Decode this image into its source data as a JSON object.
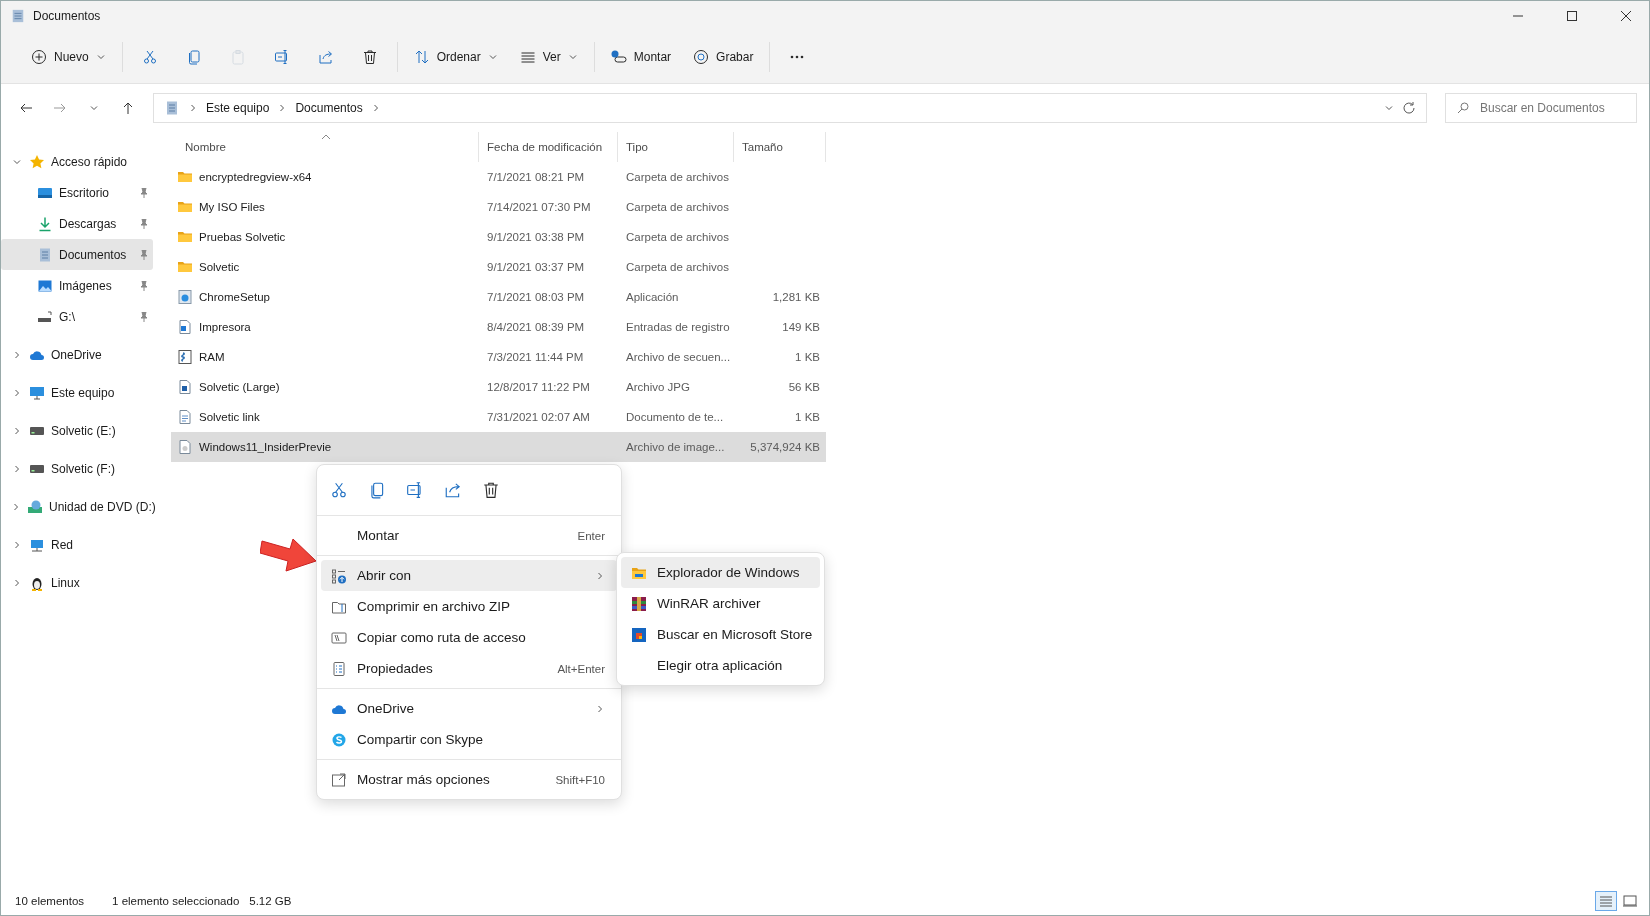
{
  "window": {
    "title": "Documentos"
  },
  "toolbar": {
    "groups": [
      [
        {
          "kind": "new",
          "label": "Nuevo",
          "dropdown": true,
          "disabled": false
        }
      ],
      [
        {
          "kind": "cut",
          "disabled": false
        },
        {
          "kind": "copy",
          "disabled": false
        },
        {
          "kind": "paste",
          "disabled": true
        },
        {
          "kind": "rename",
          "disabled": false
        },
        {
          "kind": "share",
          "disabled": false
        },
        {
          "kind": "delete",
          "disabled": false
        }
      ],
      [
        {
          "kind": "sort",
          "label": "Ordenar",
          "dropdown": true,
          "disabled": false
        },
        {
          "kind": "view",
          "label": "Ver",
          "dropdown": true,
          "disabled": false
        }
      ],
      [
        {
          "kind": "mount",
          "label": "Montar",
          "dropdown": false,
          "disabled": false
        },
        {
          "kind": "burn",
          "label": "Grabar",
          "dropdown": false,
          "disabled": false
        }
      ],
      [
        {
          "kind": "more",
          "disabled": false
        }
      ]
    ]
  },
  "address": {
    "breadcrumb": [
      "Este equipo",
      "Documentos"
    ]
  },
  "search": {
    "placeholder": "Buscar en Documentos"
  },
  "sidebar": {
    "items": [
      {
        "label": "Acceso rápido",
        "kind": "star",
        "expanded": true,
        "selected": false,
        "children": [
          {
            "label": "Escritorio",
            "kind": "desktop",
            "pinned": true,
            "selected": false
          },
          {
            "label": "Descargas",
            "kind": "download",
            "pinned": true,
            "selected": false
          },
          {
            "label": "Documentos",
            "kind": "documents",
            "pinned": true,
            "selected": true
          },
          {
            "label": "Imágenes",
            "kind": "pictures",
            "pinned": true,
            "selected": false
          },
          {
            "label": "G:\\",
            "kind": "usb",
            "pinned": true,
            "selected": false
          }
        ]
      },
      {
        "label": "OneDrive",
        "kind": "cloud",
        "expanded": false,
        "selected": false
      },
      {
        "label": "Este equipo",
        "kind": "computer",
        "expanded": false,
        "selected": false
      },
      {
        "label": "Solvetic (E:)",
        "kind": "drive",
        "expanded": false,
        "selected": false
      },
      {
        "label": "Solvetic (F:)",
        "kind": "drive",
        "expanded": false,
        "selected": false
      },
      {
        "label": "Unidad de DVD (D:)",
        "kind": "dvd",
        "expanded": false,
        "selected": false
      },
      {
        "label": "Red",
        "kind": "network",
        "expanded": false,
        "selected": false
      },
      {
        "label": "Linux",
        "kind": "linux",
        "expanded": false,
        "selected": false
      }
    ]
  },
  "table": {
    "columns": [
      "Nombre",
      "Fecha de modificación",
      "Tipo",
      "Tamaño"
    ],
    "rows": [
      {
        "kind": "folder",
        "name": "encryptedregview-x64",
        "date": "7/1/2021 08:21 PM",
        "type": "Carpeta de archivos",
        "selected": false
      },
      {
        "kind": "folder",
        "name": "My ISO Files",
        "date": "7/14/2021 07:30 PM",
        "type": "Carpeta de archivos",
        "selected": false
      },
      {
        "kind": "folder",
        "name": "Pruebas Solvetic",
        "date": "9/1/2021 03:38 PM",
        "type": "Carpeta de archivos",
        "selected": false
      },
      {
        "kind": "folder",
        "name": "Solvetic",
        "date": "9/1/2021 03:37 PM",
        "type": "Carpeta de archivos",
        "selected": false
      },
      {
        "kind": "app",
        "name": "ChromeSetup",
        "date": "7/1/2021 08:03 PM",
        "type": "Aplicación",
        "size": "1,281 KB",
        "selected": false
      },
      {
        "kind": "registry",
        "name": "Impresora",
        "date": "8/4/2021 08:39 PM",
        "type": "Entradas de registro",
        "size": "149 KB",
        "selected": false
      },
      {
        "kind": "script",
        "name": "RAM",
        "date": "7/3/2021 11:44 PM",
        "type": "Archivo de secuen...",
        "size": "1 KB",
        "selected": false
      },
      {
        "kind": "image",
        "name": "Solvetic (Large)",
        "date": "12/8/2017 11:22 PM",
        "type": "Archivo JPG",
        "size": "56 KB",
        "selected": false
      },
      {
        "kind": "link",
        "name": "Solvetic link",
        "date": "7/31/2021 02:07 AM",
        "type": "Documento de te...",
        "size": "1 KB",
        "selected": false
      },
      {
        "kind": "disc",
        "name": "Windows11_InsiderPrevie",
        "type": "Archivo de image...",
        "size": "5,374,924 KB",
        "selected": true
      }
    ]
  },
  "context_menu": {
    "actions": [
      {
        "kind": "cut"
      },
      {
        "kind": "copy"
      },
      {
        "kind": "rename"
      },
      {
        "kind": "share"
      },
      {
        "kind": "delete"
      }
    ],
    "groups": [
      [
        {
          "kind": "none",
          "label": "Montar",
          "shortcut": "Enter",
          "submenu": false,
          "highlighted": false
        }
      ],
      [
        {
          "kind": "openwith",
          "label": "Abrir con",
          "submenu": true,
          "highlighted": true
        },
        {
          "kind": "zip",
          "label": "Comprimir en archivo ZIP",
          "submenu": false,
          "highlighted": false
        },
        {
          "kind": "path",
          "label": "Copiar como ruta de acceso",
          "submenu": false,
          "highlighted": false
        },
        {
          "kind": "properties",
          "label": "Propiedades",
          "shortcut": "Alt+Enter",
          "submenu": false,
          "highlighted": false
        }
      ],
      [
        {
          "kind": "cloud",
          "label": "OneDrive",
          "submenu": true,
          "highlighted": false
        },
        {
          "kind": "skype",
          "label": "Compartir con Skype",
          "submenu": false,
          "highlighted": false
        }
      ],
      [
        {
          "kind": "more",
          "label": "Mostrar más opciones",
          "shortcut": "Shift+F10",
          "submenu": false,
          "highlighted": false
        }
      ]
    ]
  },
  "submenu": {
    "items": [
      {
        "kind": "explorer",
        "label": "Explorador de Windows",
        "highlighted": true
      },
      {
        "kind": "winrar",
        "label": "WinRAR archiver",
        "highlighted": false
      },
      {
        "kind": "store",
        "label": "Buscar en Microsoft Store",
        "highlighted": false
      },
      {
        "kind": "none",
        "label": "Elegir otra aplicación",
        "highlighted": false
      }
    ]
  },
  "status_bar": {
    "count": "10 elementos",
    "selection": "1 elemento seleccionado",
    "size": "5.12 GB"
  },
  "view_toggle": [
    {
      "kind": "details",
      "selected": true
    },
    {
      "kind": "tiles",
      "selected": false
    }
  ]
}
